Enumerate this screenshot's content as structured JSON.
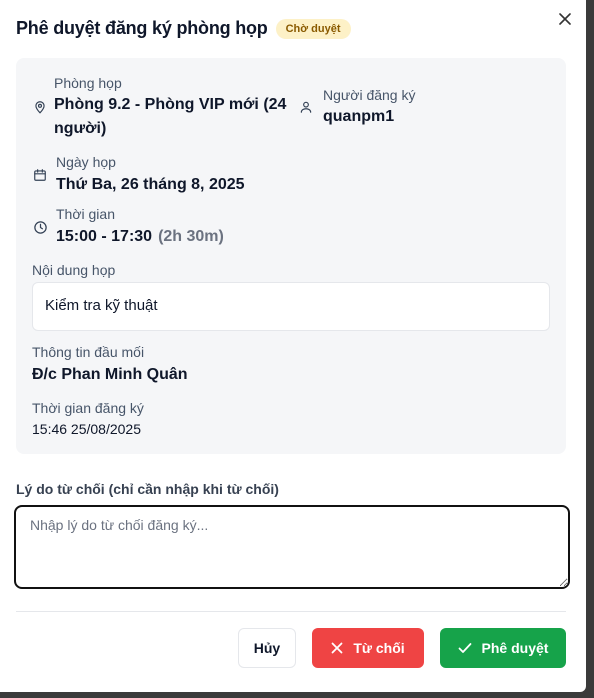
{
  "modal": {
    "title": "Phê duyệt đăng ký phòng họp",
    "status_badge": "Chờ duyệt"
  },
  "details": {
    "room_label": "Phòng họp",
    "room_value_line1": "Phòng 9.2 - Phòng VIP mới (24",
    "room_value_line2": "người)",
    "registrant_label": "Người đăng ký",
    "registrant_value": "quanpm1",
    "date_label": "Ngày họp",
    "date_value": "Thứ Ba, 26 tháng 8, 2025",
    "time_label": "Thời gian",
    "time_value": "15:00 - 17:30",
    "time_duration": "(2h 30m)",
    "content_label": "Nội dung họp",
    "content_value": "Kiểm tra kỹ thuật",
    "contact_label": "Thông tin đầu mối",
    "contact_value": "Đ/c Phan Minh Quân",
    "registered_at_label": "Thời gian đăng ký",
    "registered_at_value": "15:46 25/08/2025"
  },
  "reason": {
    "label": "Lý do từ chối (chỉ cần nhập khi từ chối)",
    "placeholder": "Nhập lý do từ chối đăng ký..."
  },
  "actions": {
    "cancel_label": "Hủy",
    "reject_label": "Từ chối",
    "approve_label": "Phê duyệt"
  },
  "icons": {
    "close": "close-icon",
    "room": "map-pin-icon",
    "registrant": "user-icon",
    "date": "calendar-icon",
    "time": "clock-icon",
    "reject": "x-icon",
    "approve": "check-icon"
  },
  "colors": {
    "badge_bg": "#fdf1c7",
    "badge_text": "#8a5a00",
    "reject": "#ef4444",
    "approve": "#16a34a",
    "card_bg": "#f5f6f8"
  }
}
